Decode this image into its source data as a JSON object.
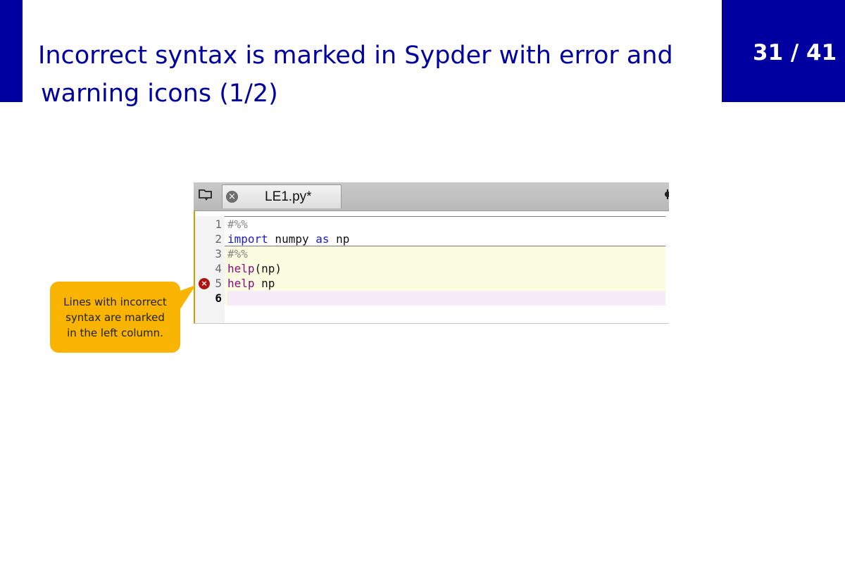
{
  "slide": {
    "title_line1": "Incorrect syntax is marked in Sypder with error and",
    "title_line2": "warning icons (1/2)",
    "page_number": "31 / 41"
  },
  "editor": {
    "tab_label": "LE1.py*",
    "tab_close_glyph": "×",
    "icons": [
      "browse-tabs-icon",
      "close-icon",
      "gear-icon",
      "error-icon"
    ],
    "lines": [
      {
        "num": "1",
        "tokens": [
          {
            "text": "#%%",
            "kind": "comment"
          }
        ]
      },
      {
        "num": "2",
        "tokens": [
          {
            "text": "import",
            "kind": "kw"
          },
          {
            "text": " numpy ",
            "kind": "plain"
          },
          {
            "text": "as",
            "kind": "kw"
          },
          {
            "text": " np",
            "kind": "plain"
          }
        ]
      },
      {
        "num": "3",
        "tokens": [
          {
            "text": "#%%",
            "kind": "comment"
          }
        ]
      },
      {
        "num": "4",
        "tokens": [
          {
            "text": "help",
            "kind": "bi"
          },
          {
            "text": "(np)",
            "kind": "plain"
          }
        ]
      },
      {
        "num": "5",
        "tokens": [
          {
            "text": "help",
            "kind": "bi"
          },
          {
            "text": " np",
            "kind": "plain"
          }
        ],
        "error": true
      },
      {
        "num": "6",
        "tokens": [],
        "current": true
      }
    ],
    "error_glyph": "×"
  },
  "callout": {
    "line1": "Lines with incorrect",
    "line2": "syntax are marked",
    "line3": "in the left column."
  },
  "colors": {
    "brand_blue": "#0000a0",
    "callout_yellow": "#f8b400",
    "error_red": "#b11313"
  }
}
